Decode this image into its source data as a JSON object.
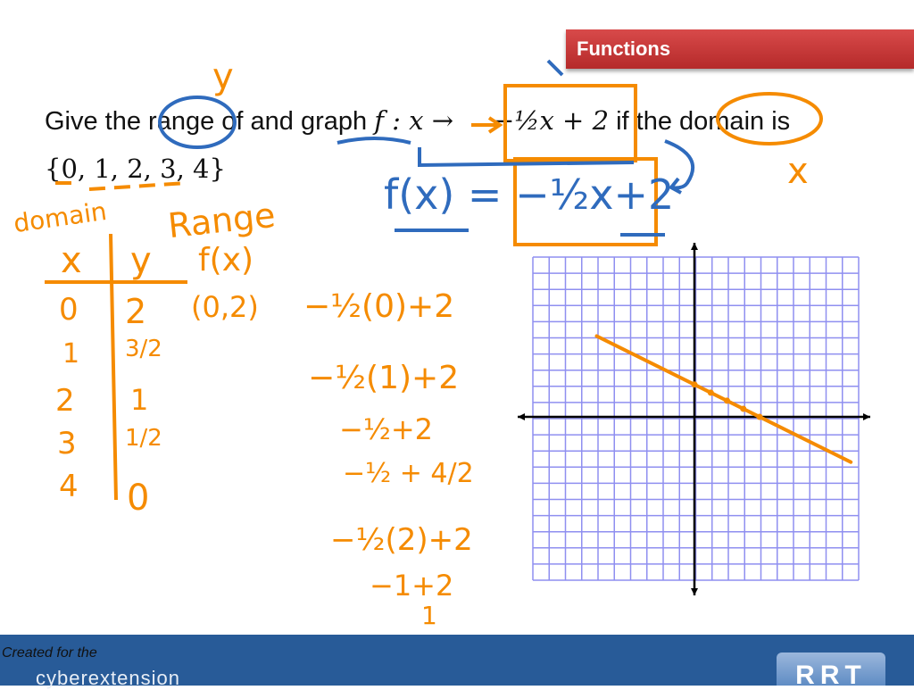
{
  "slide": {
    "title": "Functions",
    "question_line1_prefix": "Give the range of and graph",
    "question_func": "f : x →",
    "question_expr": "−½x + 2",
    "question_suffix": "if the domain is",
    "question_line2": "{0, 1, 2, 3, 4}"
  },
  "handwriting": {
    "y_label": "y",
    "x_label": "x",
    "equation": "f(x) = −½x+2",
    "domain_label": "domain",
    "range_label": "Range",
    "fx_label": "f(x)",
    "table_header_x": "x",
    "table_header_y": "y",
    "table_x": [
      "0",
      "1",
      "2",
      "3",
      "4"
    ],
    "table_y": [
      "2",
      "3/2",
      "1",
      "1/2",
      "0"
    ],
    "point": "(0,2)",
    "work": [
      "−½(0)+2",
      "−½(1)+2",
      "−½+2",
      "−½ + 4/2",
      "−½(2)+2",
      "−1+2",
      "1"
    ]
  },
  "graph": {
    "grid_color": "#8f8ff0",
    "line_color": "#f58b00",
    "x_range": [
      -10,
      10
    ],
    "y_range": [
      -10,
      10
    ],
    "plotted_function": "y = -0.5x + 2"
  },
  "footer": {
    "created_for": "Created for the",
    "brand": "cyberextension",
    "logo": "RRT",
    "color": "#285b98"
  }
}
